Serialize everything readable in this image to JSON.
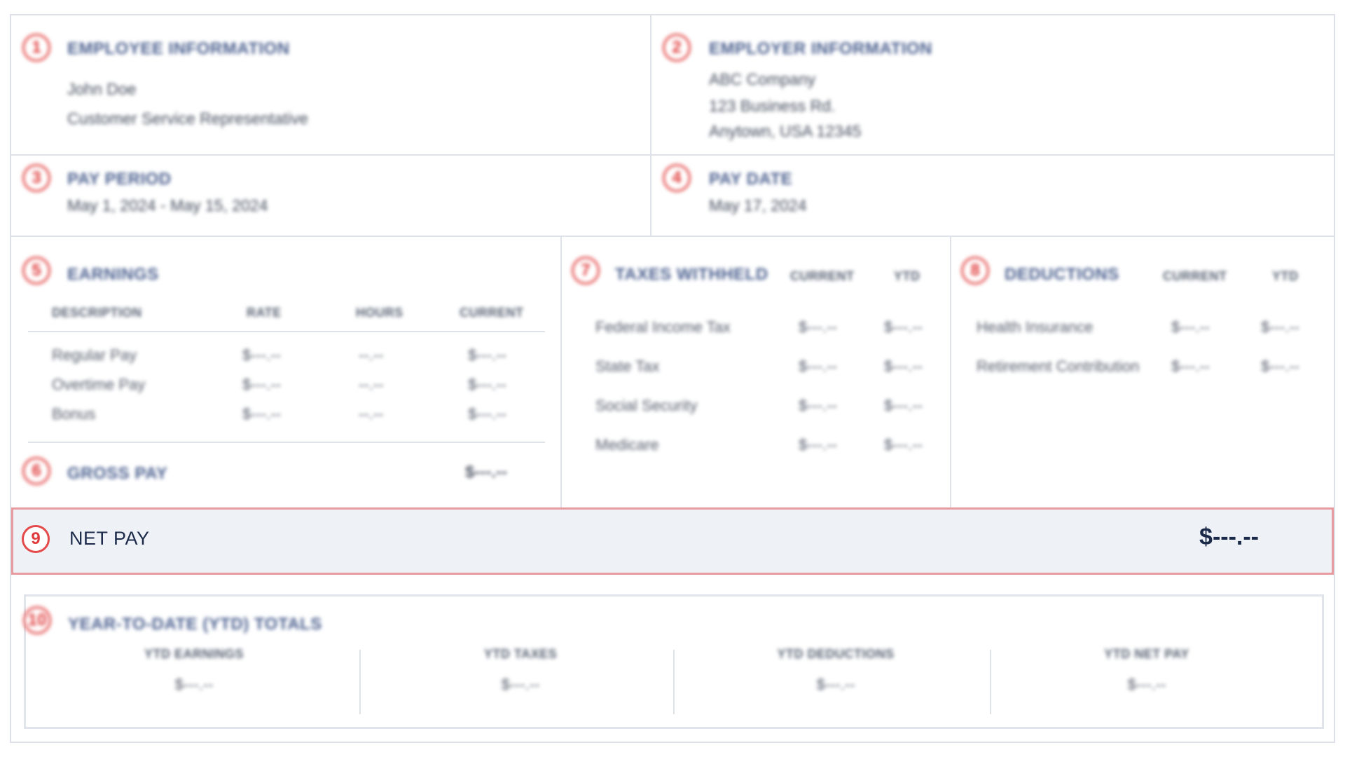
{
  "employee": {
    "badge": "1",
    "title": "EMPLOYEE INFORMATION",
    "name": "John Doe",
    "position": "Customer Service Representative"
  },
  "employer": {
    "badge": "2",
    "title": "EMPLOYER INFORMATION",
    "company": "ABC Company",
    "address1": "123 Business Rd.",
    "address2": "Anytown, USA 12345"
  },
  "pay_period": {
    "badge": "3",
    "title": "PAY PERIOD",
    "value": "May 1, 2024 - May 15, 2024"
  },
  "pay_date": {
    "badge": "4",
    "title": "PAY DATE",
    "value": "May 17, 2024"
  },
  "earnings": {
    "badge": "5",
    "title": "EARNINGS",
    "headers": [
      "DESCRIPTION",
      "RATE",
      "HOURS",
      "CURRENT"
    ],
    "rows": [
      [
        "Regular Pay",
        "$---.--",
        "--.--",
        "$---.--"
      ],
      [
        "Overtime Pay",
        "$---.--",
        "--.--",
        "$---.--"
      ],
      [
        "Bonus",
        "$---.--",
        "--.--",
        "$---.--"
      ]
    ]
  },
  "gross_pay": {
    "badge": "6",
    "title": "GROSS PAY",
    "value": "$---.--"
  },
  "taxes": {
    "badge": "7",
    "title": "TAXES WITHHELD",
    "headers": [
      "CURRENT",
      "YTD"
    ],
    "rows": [
      [
        "Federal Income Tax",
        "$---.--",
        "$---.--"
      ],
      [
        "State Tax",
        "$---.--",
        "$---.--"
      ],
      [
        "Social Security",
        "$---.--",
        "$---.--"
      ],
      [
        "Medicare",
        "$---.--",
        "$---.--"
      ]
    ]
  },
  "deductions": {
    "badge": "8",
    "title": "DEDUCTIONS",
    "headers": [
      "CURRENT",
      "YTD"
    ],
    "rows": [
      [
        "Health Insurance",
        "$---.--",
        "$---.--"
      ],
      [
        "Retirement Contribution",
        "$---.--",
        "$---.--"
      ]
    ]
  },
  "net_pay": {
    "badge": "9",
    "label": "NET PAY",
    "amount": "$---.--"
  },
  "ytd": {
    "badge": "10",
    "title": "YEAR-TO-DATE (YTD) TOTALS",
    "columns": [
      {
        "label": "YTD EARNINGS",
        "value": "$---.--"
      },
      {
        "label": "YTD TAXES",
        "value": "$---.--"
      },
      {
        "label": "YTD DEDUCTIONS",
        "value": "$---.--"
      },
      {
        "label": "YTD NET PAY",
        "value": "$---.--"
      }
    ]
  },
  "colors": {
    "badge_red": "#e03a3a",
    "title_blue": "#4a5f8e",
    "netpay_bg": "#eef1f6",
    "netpay_border": "#e79a9f"
  }
}
